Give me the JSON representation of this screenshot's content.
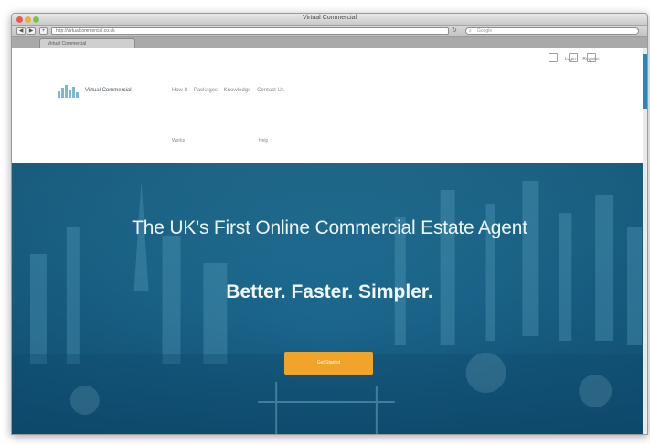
{
  "window": {
    "title": "Virtual Commercial"
  },
  "toolbar": {
    "back_glyph": "◀",
    "forward_glyph": "▶",
    "plus_glyph": "+",
    "address": "http://virtualcommercial.co.uk",
    "reload_glyph": "↻",
    "search_placeholder": "Google"
  },
  "tabs": [
    {
      "label": "Virtual Commercial"
    }
  ],
  "site": {
    "top_links": [
      "Login",
      "Register"
    ],
    "social_icons": [
      "facebook-icon",
      "twitter-icon",
      "linkedin-icon"
    ],
    "logo_text": "Virtual Commercial",
    "nav": [
      "How It",
      "Packages",
      "Knowledge",
      "Contact Us"
    ],
    "subnav": [
      "Works",
      "Help"
    ]
  },
  "hero": {
    "headline": "The UK's First Online Commercial Estate Agent",
    "tagline": "Better. Faster. Simpler.",
    "cta_label": "Get Started"
  },
  "colors": {
    "hero_overlay": "#1f6e96",
    "cta": "#f0a42a",
    "accent": "#2a86b6"
  }
}
